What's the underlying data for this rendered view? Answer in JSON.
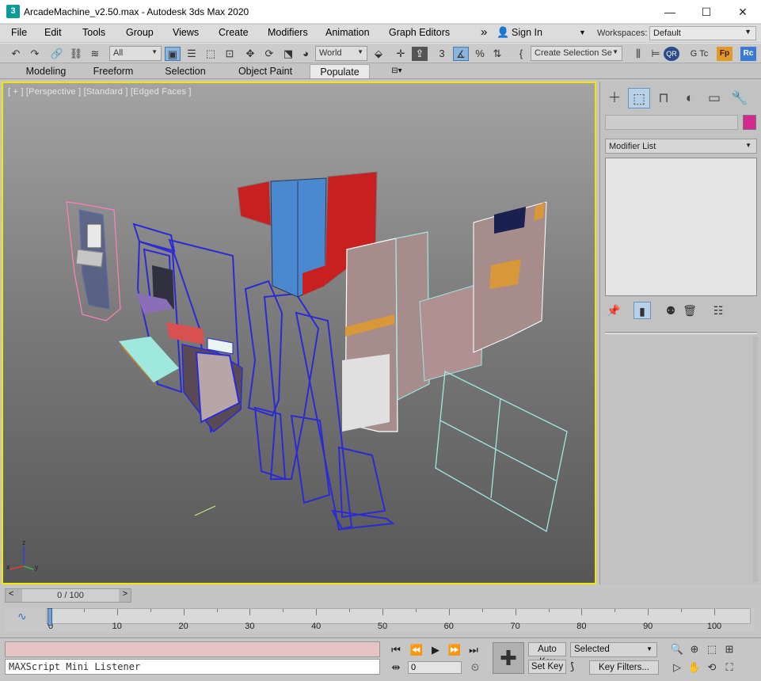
{
  "window": {
    "title": "ArcadeMachine_v2.50.max - Autodesk 3ds Max 2020",
    "app_icon_text": "3"
  },
  "menu": [
    "File",
    "Edit",
    "Tools",
    "Group",
    "Views",
    "Create",
    "Modifiers",
    "Animation",
    "Graph Editors"
  ],
  "menu_more": "»",
  "account": {
    "sign_in": "Sign In"
  },
  "workspaces": {
    "label": "Workspaces:",
    "value": "Default"
  },
  "toolbar": {
    "selection_filter": "All",
    "reference_coord": "World",
    "named_selection": "Create Selection Se",
    "truncated_label": "G Tc",
    "badge_qr": "QR",
    "badge_fp": "Fp",
    "badge_rc": "Rc"
  },
  "ribbon": {
    "tabs": [
      "Modeling",
      "Freeform",
      "Selection",
      "Object Paint",
      "Populate"
    ],
    "active": "Populate"
  },
  "viewport": {
    "label": "[ + ] [Perspective ] [Standard ] [Edged Faces ]",
    "axis_z": "z",
    "axis_x": "x",
    "axis_y": "y"
  },
  "command_panel": {
    "tabs": [
      "create-icon",
      "modify-icon",
      "hierarchy-icon",
      "motion-icon",
      "display-icon",
      "utilities-icon"
    ],
    "active_tab": "modify-icon",
    "modifier_list": "Modifier List",
    "object_color": "#d4288f"
  },
  "timeline": {
    "frame_readout": "0 / 100",
    "ticks": [
      "0",
      "10",
      "20",
      "30",
      "40",
      "50",
      "60",
      "70",
      "80",
      "90",
      "100"
    ]
  },
  "status": {
    "maxscript_placeholder": "MAXScript Mini Listener",
    "frame_value": "0",
    "auto_key": "Auto Key",
    "set_key": "Set Key",
    "selected_option": "Selected",
    "key_filters": "Key Filters..."
  },
  "colors": {
    "viewport_border": "#f5e600",
    "wire_blue": "#2b2bd4",
    "wire_cyan": "#9ee8e2",
    "wire_pink": "#ff7fbf"
  }
}
